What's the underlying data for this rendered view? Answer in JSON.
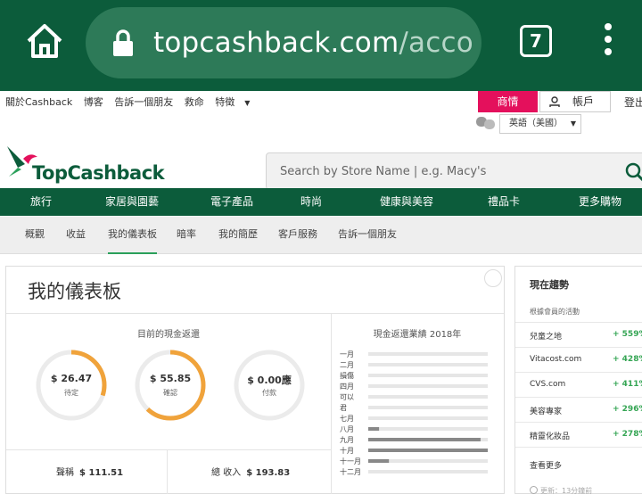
{
  "browser": {
    "url_main": "topcashback.com",
    "url_rest": "/acco",
    "tab_count": "7"
  },
  "header": {
    "topnav": [
      "關於Cashback",
      "博客",
      "告訴一個朋友",
      "救命",
      "特徵"
    ],
    "deals_label": "商情",
    "account_label": "帳戶",
    "logout_label": "登出",
    "language": "英語（美國）"
  },
  "brand": {
    "name": "TopCashback",
    "color": "#0c5c3b"
  },
  "search": {
    "placeholder": "Search by Store Name | e.g. Macy's"
  },
  "categories": [
    "旅行",
    "家居與園藝",
    "電子產品",
    "時尚",
    "健康與美容",
    "禮品卡",
    "更多購物"
  ],
  "subnav": {
    "items": [
      "概觀",
      "收益",
      "我的儀表板",
      "暗率",
      "我的簡歷",
      "客戶服務",
      "告訴一個朋友"
    ],
    "active_index": 2
  },
  "dashboard": {
    "title": "我的儀表板",
    "cashback_title": "目前的現金返還",
    "rings": [
      {
        "value": "$ 26.47",
        "label": "待定",
        "fraction": 0.3
      },
      {
        "value": "$ 55.85",
        "label": "確認",
        "fraction": 0.62
      },
      {
        "value": "$ 0.00",
        "suffix": "應",
        "label": "付款",
        "fraction": 0
      }
    ],
    "totals": [
      {
        "label": "聲稱",
        "value": "$ 111.51"
      },
      {
        "label": "總  收入",
        "value": "$ 193.83"
      }
    ],
    "accent_color": "#f0a33b"
  },
  "chart_data": {
    "type": "bar",
    "orientation": "horizontal",
    "title": "現金返還業績 2018年",
    "categories": [
      "一月",
      "二月",
      "損傷",
      "四月",
      "可以",
      "君",
      "七月",
      "八月",
      "九月",
      "十月",
      "十一月",
      "十二月"
    ],
    "values": [
      0,
      0,
      0,
      0,
      0,
      0,
      0,
      12,
      125,
      133,
      23,
      0
    ],
    "xlim": [
      0,
      133
    ],
    "bar_color": "#888888",
    "track_color": "#e6e6e6"
  },
  "trending": {
    "title": "現在趨勢",
    "subtitle": "根據會員的活動",
    "items": [
      {
        "store": "兒童之地",
        "pct": "+ 559%"
      },
      {
        "store": "Vitacost.com",
        "pct": "+ 428%"
      },
      {
        "store": "CVS.com",
        "pct": "+ 411%"
      },
      {
        "store": "美容專家",
        "pct": "+ 296%"
      },
      {
        "store": "精靈化妝品",
        "pct": "+ 278%"
      }
    ],
    "more_label": "查看更多",
    "updated": "更新：13分鐘前",
    "pct_color": "#35a554"
  }
}
